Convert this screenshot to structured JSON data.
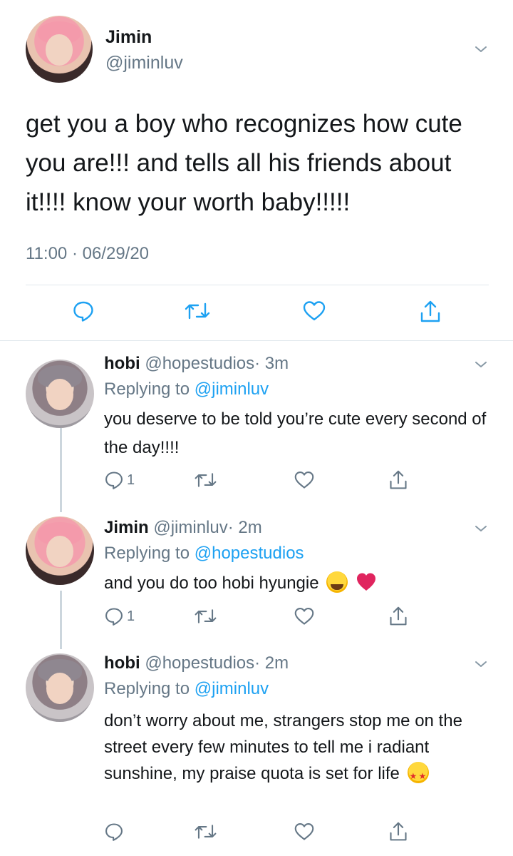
{
  "main_tweet": {
    "name": "Jimin",
    "handle": "@jiminluv",
    "text": "get you a boy who recognizes how cute you are!!! and tells all his friends about it!!!! know your worth baby!!!!!",
    "timestamp": "11:00 · 06/29/20",
    "avatar": "jimin-avatar"
  },
  "replies": [
    {
      "name": "hobi",
      "handle": "@hopestudios",
      "time": "· 3m",
      "replying_prefix": "Replying to ",
      "replying_to": "@jiminluv",
      "text": "you deserve to be told you’re cute every second of the day!!!!",
      "reply_count": "1",
      "avatar": "hobi-avatar"
    },
    {
      "name": "Jimin",
      "handle": "@jiminluv",
      "time": "· 2m",
      "replying_prefix": "Replying to ",
      "replying_to": "@hopestudios",
      "text": "and you do too hobi hyungie",
      "emojis": [
        "face-with-steam-emoji",
        "red-heart-emoji"
      ],
      "reply_count": "1",
      "avatar": "jimin-avatar"
    },
    {
      "name": "hobi",
      "handle": "@hopestudios",
      "time": "· 2m",
      "replying_prefix": "Replying to ",
      "replying_to": "@jiminluv",
      "text": "don’t worry about me, strangers stop me on the street every few minutes to tell me i radiant sunshine, my praise quota is set for life",
      "emojis": [
        "star-struck-emoji"
      ],
      "reply_count": "",
      "avatar": "hobi-avatar"
    }
  ],
  "colors": {
    "text": "#14171a",
    "secondary": "#657786",
    "link": "#1da1f2",
    "divider": "#e1e8ed",
    "thread_line": "#ccd6dd",
    "heart": "#e0245e"
  },
  "icons": [
    "reply-icon",
    "retweet-icon",
    "like-icon",
    "share-icon",
    "chevron-down-icon"
  ]
}
